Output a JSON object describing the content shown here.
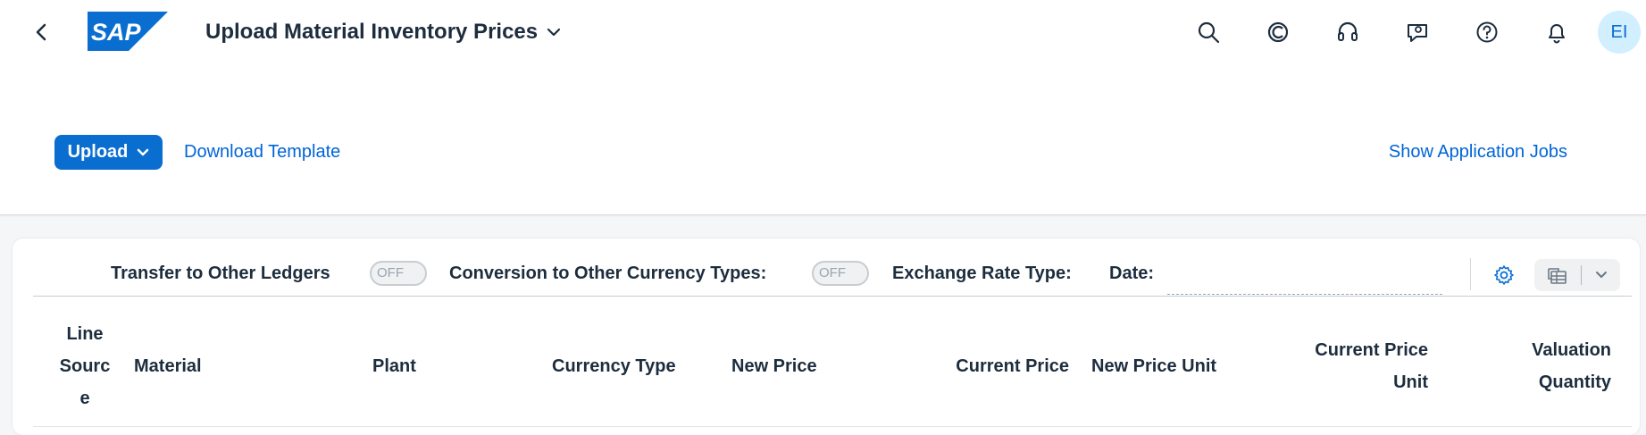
{
  "shell": {
    "app_title": "Upload Material Inventory Prices",
    "logo_text": "SAP",
    "user_initials": "EI",
    "icons": [
      "back-icon",
      "search-icon",
      "joule-icon",
      "headset-icon",
      "feedback-icon",
      "help-icon",
      "notification-icon"
    ]
  },
  "header": {
    "upload_label": "Upload",
    "download_template_label": "Download Template",
    "show_jobs_label": "Show Application Jobs"
  },
  "toolbar": {
    "transfer_label": "Transfer to Other Ledgers",
    "transfer_switch": "OFF",
    "conversion_label": "Conversion to Other Currency Types:",
    "conversion_switch": "OFF",
    "exchange_rate_label": "Exchange Rate Type:",
    "date_label": "Date:",
    "date_value": ""
  },
  "table": {
    "columns": [
      {
        "line1": "Line",
        "line2": "Sourc",
        "line3": "e"
      },
      {
        "line1": "Material"
      },
      {
        "line1": "Plant"
      },
      {
        "line1": "Currency Type"
      },
      {
        "line1": "New Price"
      },
      {
        "line1": "Current Price"
      },
      {
        "line1": "New Price Unit"
      },
      {
        "line1": "Current Price",
        "line2": "Unit"
      },
      {
        "line1": "Valuation",
        "line2": "Quantity"
      }
    ]
  },
  "colors": {
    "accent": "#0a6ed1",
    "link": "#0064d9",
    "text": "#1d2d3e",
    "background": "#f5f6f7"
  }
}
